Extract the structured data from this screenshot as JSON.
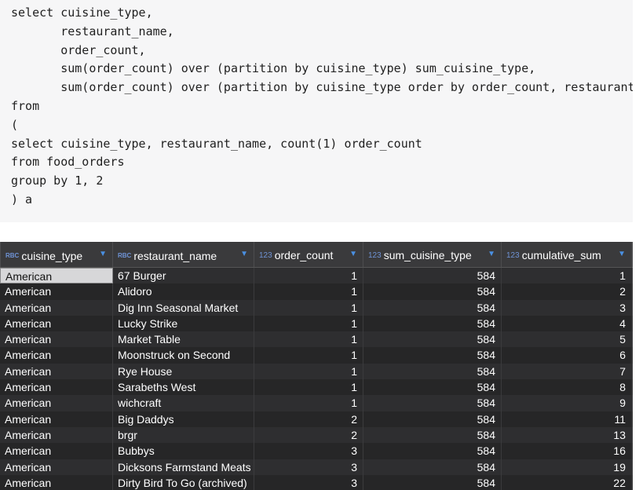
{
  "sql_code": "select cuisine_type,\n       restaurant_name,\n       order_count,\n       sum(order_count) over (partition by cuisine_type) sum_cuisine_type,\n       sum(order_count) over (partition by cuisine_type order by order_count, restaurant_name) cumulative_sum\nfrom\n(\nselect cuisine_type, restaurant_name, count(1) order_count\nfrom food_orders\ngroup by 1, 2\n) a",
  "columns": [
    {
      "name": "cuisine_type",
      "type_badge": "RBC",
      "kind": "text"
    },
    {
      "name": "restaurant_name",
      "type_badge": "RBC",
      "kind": "text"
    },
    {
      "name": "order_count",
      "type_badge": "123",
      "kind": "number"
    },
    {
      "name": "sum_cuisine_type",
      "type_badge": "123",
      "kind": "number"
    },
    {
      "name": "cumulative_sum",
      "type_badge": "123",
      "kind": "number"
    }
  ],
  "rows": [
    [
      "American",
      "67 Burger",
      "1",
      "584",
      "1"
    ],
    [
      "American",
      "Alidoro",
      "1",
      "584",
      "2"
    ],
    [
      "American",
      "Dig Inn Seasonal Market",
      "1",
      "584",
      "3"
    ],
    [
      "American",
      "Lucky Strike",
      "1",
      "584",
      "4"
    ],
    [
      "American",
      "Market Table",
      "1",
      "584",
      "5"
    ],
    [
      "American",
      "Moonstruck on Second",
      "1",
      "584",
      "6"
    ],
    [
      "American",
      "Rye House",
      "1",
      "584",
      "7"
    ],
    [
      "American",
      "Sarabeths West",
      "1",
      "584",
      "8"
    ],
    [
      "American",
      "wichcraft",
      "1",
      "584",
      "9"
    ],
    [
      "American",
      "Big Daddys",
      "2",
      "584",
      "11"
    ],
    [
      "American",
      "brgr",
      "2",
      "584",
      "13"
    ],
    [
      "American",
      "Bubbys",
      "3",
      "584",
      "16"
    ],
    [
      "American",
      "Dicksons Farmstand Meats",
      "3",
      "584",
      "19"
    ],
    [
      "American",
      "Dirty Bird To Go (archived)",
      "3",
      "584",
      "22"
    ]
  ],
  "colors": {
    "accent": "#4a90e2",
    "type_icon": "#6f93d6",
    "grid_bg": "#2b2b2b",
    "header_bg": "#3a3a3c"
  },
  "icons": {
    "sort": "sort-dropdown-icon"
  }
}
